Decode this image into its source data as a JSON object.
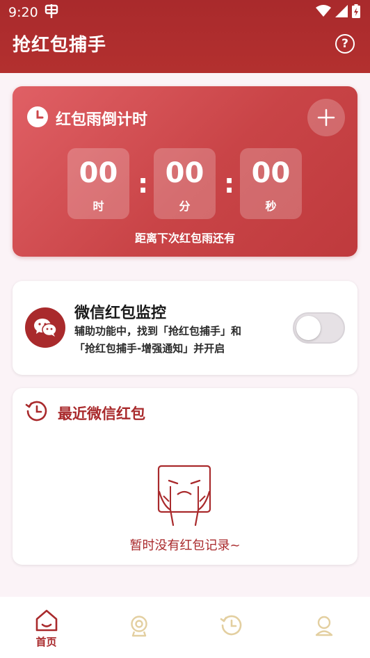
{
  "status_bar": {
    "time": "9:20",
    "icons": [
      "app-notification-icon",
      "wifi-icon",
      "cellular-signal-icon",
      "battery-charging-icon"
    ]
  },
  "app_bar": {
    "title": "抢红包捕手",
    "help_icon": "help-circle-icon"
  },
  "countdown": {
    "title": "红包雨倒计时",
    "hours": "00",
    "hours_unit": "时",
    "minutes": "00",
    "minutes_unit": "分",
    "seconds": "00",
    "seconds_unit": "秒",
    "separator": ":",
    "note": "距离下次红包雨还有"
  },
  "monitor": {
    "title": "微信红包监控",
    "desc_line1": "辅助功能中，找到「抢红包捕手」和",
    "desc_line2": "「抢红包捕手-增强通知」并开启",
    "enabled": false
  },
  "recent": {
    "title": "最近微信红包",
    "empty_text": "暂时没有红包记录~"
  },
  "bottom_nav": {
    "items": [
      {
        "label": "首页",
        "icon": "home-icon",
        "active": true
      },
      {
        "label": "",
        "icon": "webcam-icon",
        "active": false
      },
      {
        "label": "",
        "icon": "history-clock-icon",
        "active": false
      },
      {
        "label": "",
        "icon": "profile-icon",
        "active": false
      }
    ]
  },
  "colors": {
    "primary": "#a92a2c",
    "card_gradient_start": "#e06065",
    "card_gradient_end": "#bf3a3d",
    "nav_inactive": "#e3cfa0",
    "background": "#fbf3f7"
  }
}
